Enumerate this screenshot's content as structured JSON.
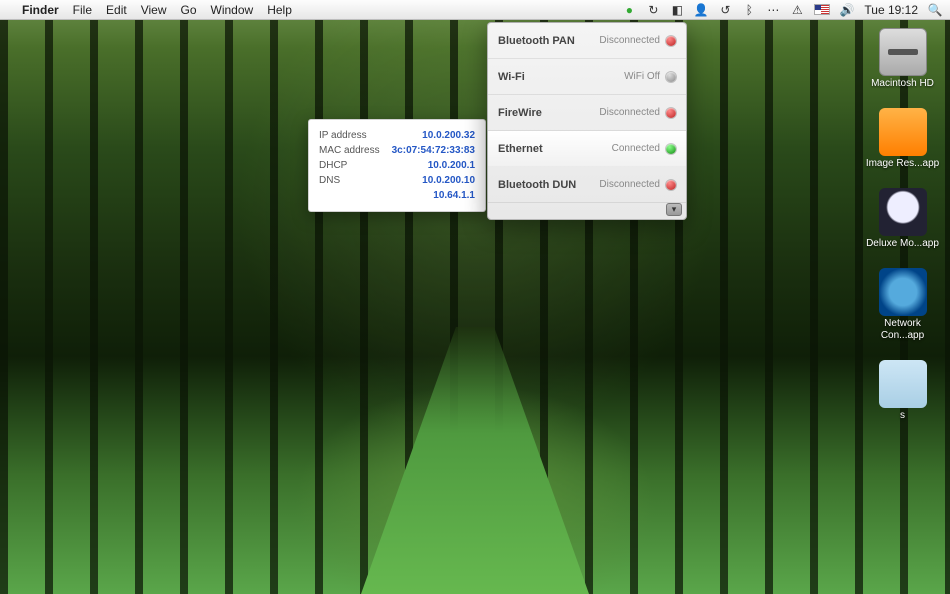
{
  "menubar": {
    "app": "Finder",
    "items": [
      "File",
      "Edit",
      "View",
      "Go",
      "Window",
      "Help"
    ],
    "clock": "Tue 19:12"
  },
  "desktop": {
    "icons": [
      {
        "label": "Macintosh HD",
        "kind": "hd"
      },
      {
        "label": "Image Res...app",
        "kind": "app1"
      },
      {
        "label": "Deluxe Mo...app",
        "kind": "app2"
      },
      {
        "label": "Network Con...app",
        "kind": "app3"
      },
      {
        "label": "s",
        "kind": "folder"
      }
    ]
  },
  "network_popup": {
    "interfaces": [
      {
        "name": "Bluetooth PAN",
        "status": "Disconnected",
        "dot": "red"
      },
      {
        "name": "Wi-Fi",
        "status": "WiFi Off",
        "dot": "gray"
      },
      {
        "name": "FireWire",
        "status": "Disconnected",
        "dot": "red"
      },
      {
        "name": "Ethernet",
        "status": "Connected",
        "dot": "green",
        "selected": true
      },
      {
        "name": "Bluetooth DUN",
        "status": "Disconnected",
        "dot": "red"
      }
    ]
  },
  "details": {
    "rows": [
      {
        "k": "IP address",
        "v": "10.0.200.32"
      },
      {
        "k": "MAC address",
        "v": "3c:07:54:72:33:83"
      },
      {
        "k": "DHCP",
        "v": "10.0.200.1"
      },
      {
        "k": "DNS",
        "v": "10.0.200.10"
      },
      {
        "k": "",
        "v": "10.64.1.1"
      }
    ]
  }
}
